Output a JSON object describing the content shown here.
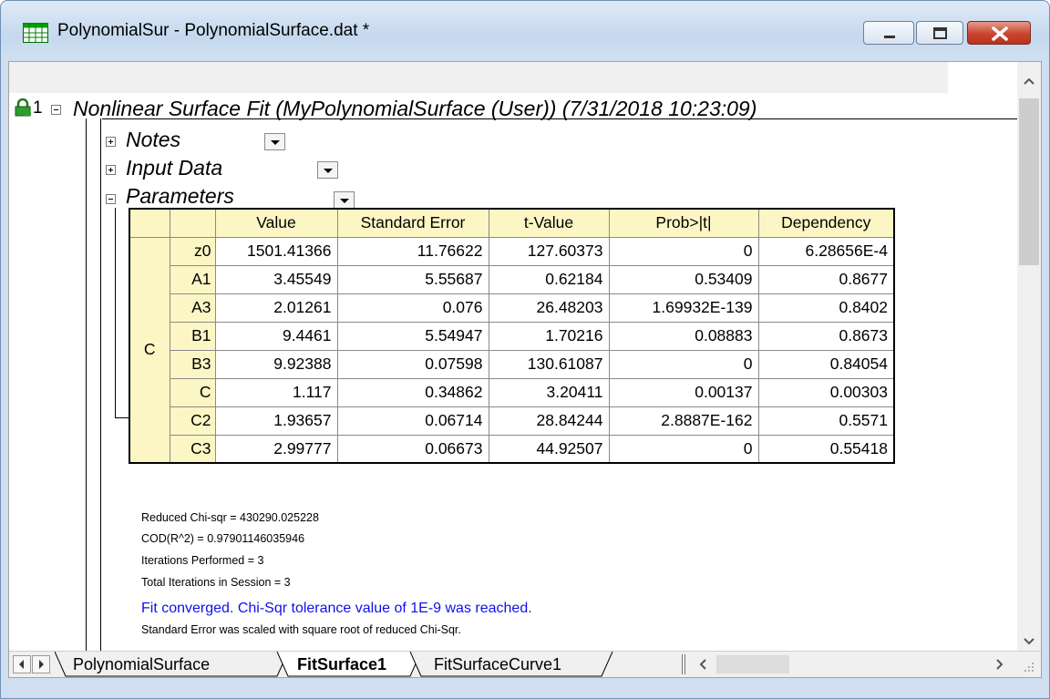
{
  "window": {
    "title": "PolynomialSur - PolynomialSurface.dat *"
  },
  "report": {
    "row_number": "1",
    "header": "Nonlinear Surface Fit (MyPolynomialSurface (User)) (7/31/2018 10:23:09)",
    "sections": {
      "notes": "Notes",
      "input_data": "Input Data",
      "parameters": "Parameters"
    }
  },
  "parameters_table": {
    "columns": [
      "Value",
      "Standard Error",
      "t-Value",
      "Prob>|t|",
      "Dependency"
    ],
    "group": "C",
    "rows": [
      {
        "name": "z0",
        "cells": [
          "1501.41366",
          "11.76622",
          "127.60373",
          "0",
          "6.28656E-4"
        ]
      },
      {
        "name": "A1",
        "cells": [
          "3.45549",
          "5.55687",
          "0.62184",
          "0.53409",
          "0.8677"
        ]
      },
      {
        "name": "A3",
        "cells": [
          "2.01261",
          "0.076",
          "26.48203",
          "1.69932E-139",
          "0.8402"
        ]
      },
      {
        "name": "B1",
        "cells": [
          "9.4461",
          "5.54947",
          "1.70216",
          "0.08883",
          "0.8673"
        ]
      },
      {
        "name": "B3",
        "cells": [
          "9.92388",
          "0.07598",
          "130.61087",
          "0",
          "0.84054"
        ]
      },
      {
        "name": "C",
        "cells": [
          "1.117",
          "0.34862",
          "3.20411",
          "0.00137",
          "0.00303"
        ]
      },
      {
        "name": "C2",
        "cells": [
          "1.93657",
          "0.06714",
          "28.84244",
          "2.8887E-162",
          "0.5571"
        ]
      },
      {
        "name": "C3",
        "cells": [
          "2.99777",
          "0.06673",
          "44.92507",
          "0",
          "0.55418"
        ]
      }
    ]
  },
  "stats": {
    "reduced_chisqr": "Reduced Chi-sqr = 430290.025228",
    "cod": "COD(R^2) = 0.97901146035946",
    "iterations": "Iterations Performed = 3",
    "total_iterations": "Total Iterations in Session = 3",
    "converged_msg": "Fit converged. Chi-Sqr tolerance value of 1E-9 was reached.",
    "scaled_msg": "Standard Error was scaled with square root of reduced Chi-Sqr."
  },
  "tabs": [
    "PolynomialSurface",
    "FitSurface1",
    "FitSurfaceCurve1"
  ],
  "active_tab": "FitSurface1",
  "colors": {
    "header_fill": "#fcf6c4",
    "message_blue": "#1010ee",
    "close_red": "#c9452f"
  },
  "icons": [
    "worksheet-icon",
    "minimize-icon",
    "maximize-icon",
    "close-icon",
    "lock-icon",
    "expand-icon",
    "collapse-icon",
    "dropdown-arrow-icon",
    "scroll-up-icon",
    "scroll-down-icon",
    "scroll-left-icon",
    "scroll-right-icon"
  ]
}
